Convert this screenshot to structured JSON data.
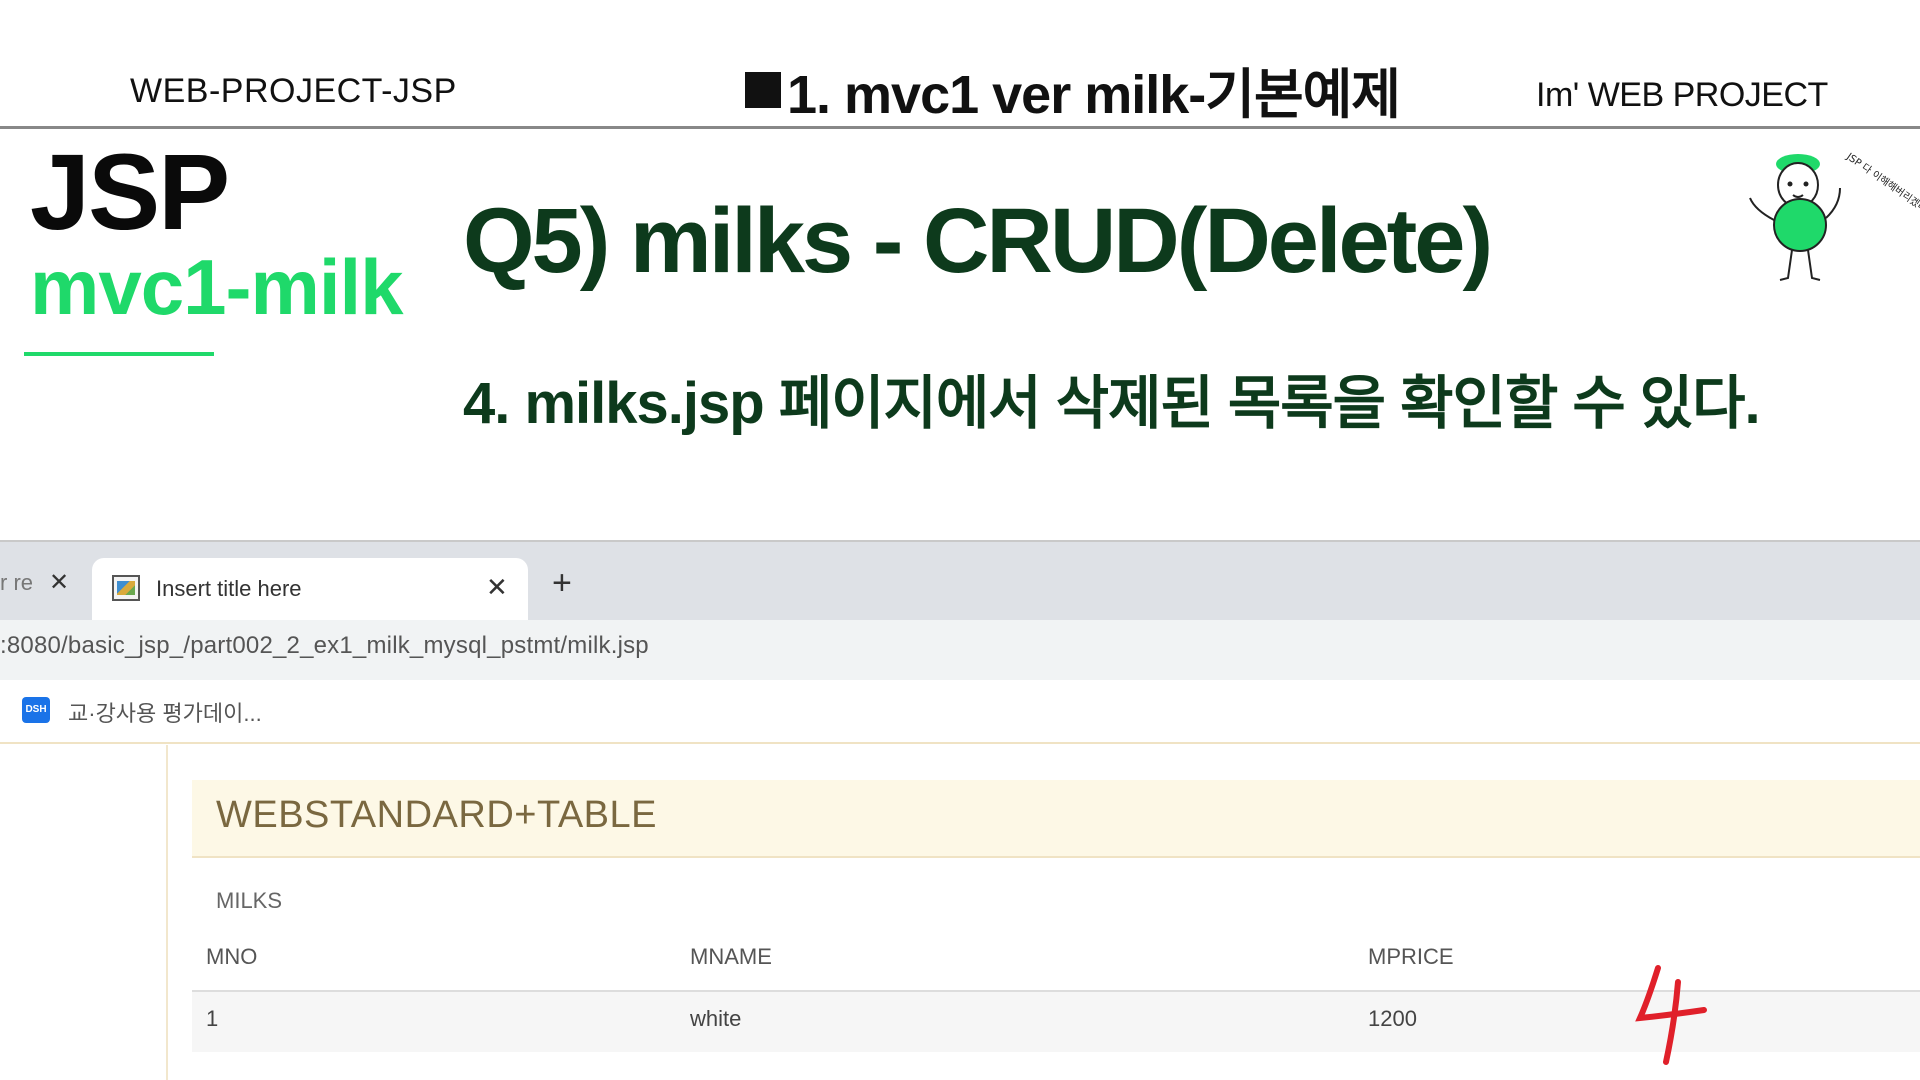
{
  "slide": {
    "header_left": "WEB-PROJECT-JSP",
    "header_center": "1. mvc1 ver  milk-기본예제",
    "header_right": "Im' WEB PROJECT",
    "brand_title": "JSP",
    "brand_subtitle": "mvc1-milk",
    "question_title": "Q5) milks - CRUD(Delete)",
    "question_subtitle": "4. milks.jsp 페이지에서 삭제된 목록을 확인할 수 있다.",
    "mascot_caption": "JSP 다 이해해버리겠다~!",
    "accent_color": "#1fd96a",
    "title_color": "#0d3a1c"
  },
  "browser": {
    "prev_tab_fragment": "r re",
    "active_tab_title": "Insert title here",
    "new_tab_symbol": "+",
    "close_symbol": "✕",
    "url": ":8080/basic_jsp_/part002_2_ex1_milk_mysql_pstmt/milk.jsp",
    "bookmark_icon_text": "DSH",
    "bookmark_label": "교·강사용 평가데이...",
    "page": {
      "panel_title": "WEBSTANDARD+TABLE",
      "table_caption": "MILKS",
      "columns": [
        "MNO",
        "MNAME",
        "MPRICE"
      ],
      "rows": [
        [
          "1",
          "white",
          "1200"
        ]
      ]
    }
  },
  "annotation": {
    "handwritten_number": "4",
    "color": "#e0202a"
  }
}
